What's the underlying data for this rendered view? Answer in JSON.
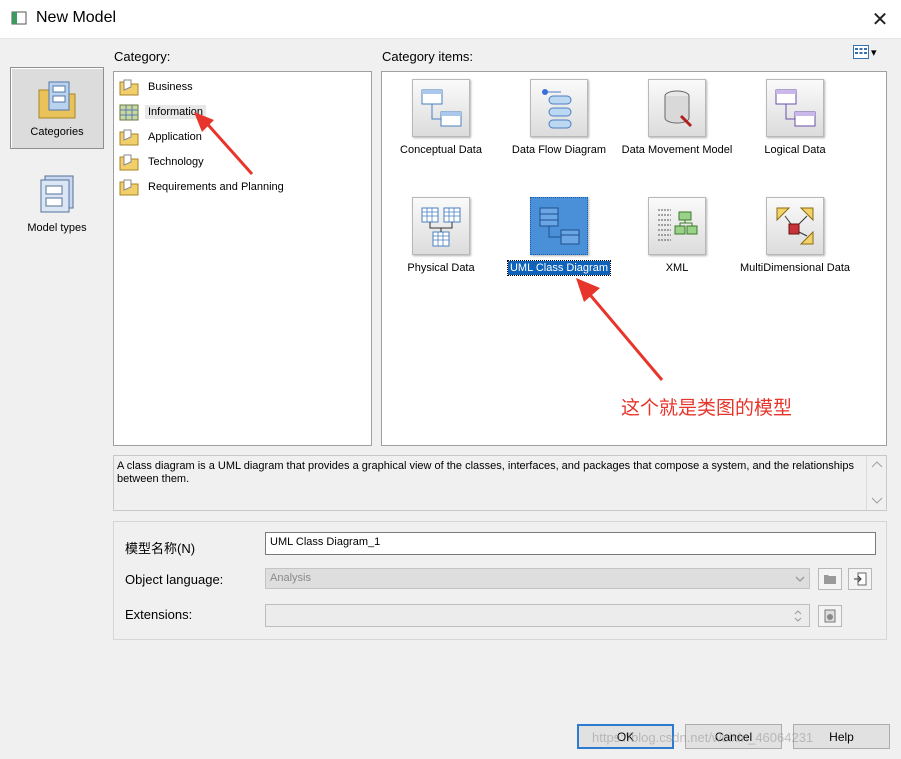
{
  "window": {
    "title": "New Model",
    "close_glyph": "✕"
  },
  "modes": [
    {
      "label": "Categories",
      "selected": true
    },
    {
      "label": "Model types",
      "selected": false
    }
  ],
  "category": {
    "label": "Category:",
    "items": [
      {
        "label": "Business",
        "icon": "folder-icon"
      },
      {
        "label": "Information",
        "icon": "grid-folder-icon",
        "selected": true
      },
      {
        "label": "Application",
        "icon": "folder-icon"
      },
      {
        "label": "Technology",
        "icon": "folder-icon"
      },
      {
        "label": "Requirements and Planning",
        "icon": "folder-icon"
      }
    ]
  },
  "items": {
    "label": "Category items:",
    "view_toggle_glyph": "▾",
    "tiles": [
      {
        "label": "Conceptual Data",
        "icon": "conceptual-data-icon"
      },
      {
        "label": "Data Flow Diagram",
        "icon": "data-flow-icon"
      },
      {
        "label": "Data Movement Model",
        "icon": "data-movement-icon"
      },
      {
        "label": "Logical Data",
        "icon": "logical-data-icon"
      },
      {
        "label": "Physical Data",
        "icon": "physical-data-icon"
      },
      {
        "label": "UML Class Diagram",
        "icon": "uml-class-icon",
        "selected": true
      },
      {
        "label": "XML",
        "icon": "xml-icon"
      },
      {
        "label": "MultiDimensional Data",
        "icon": "multidimensional-icon"
      }
    ]
  },
  "annotation": {
    "text": "这个就是类图的模型",
    "color": "#e8352b"
  },
  "description": "A class diagram is a UML diagram that provides a graphical view of the classes, interfaces, and packages that compose a system, and the relationships between them.",
  "form": {
    "name_label": "模型名称(N)",
    "name_value": "UML Class Diagram_1",
    "language_label": "Object language:",
    "language_value": "Analysis",
    "extensions_label": "Extensions:",
    "extensions_value": ""
  },
  "buttons": {
    "ok": "OK",
    "cancel": "Cancel",
    "help": "Help"
  },
  "watermark": "https://blog.csdn.net/weixin_46064231",
  "colors": {
    "selection": "#0f62b7",
    "accent_border": "#2c7bd0"
  }
}
